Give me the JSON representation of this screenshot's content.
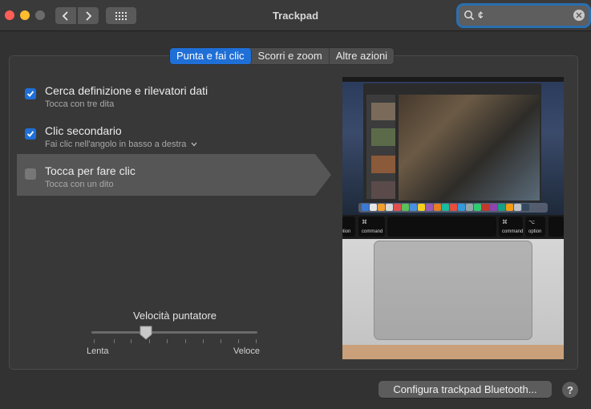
{
  "window": {
    "title": "Trackpad"
  },
  "search": {
    "value": "¢"
  },
  "tabs": [
    {
      "label": "Punta e fai clic",
      "active": true
    },
    {
      "label": "Scorri e zoom",
      "active": false
    },
    {
      "label": "Altre azioni",
      "active": false
    }
  ],
  "options": [
    {
      "title": "Cerca definizione e rilevatori dati",
      "subtitle": "Tocca con tre dita",
      "checked": true
    },
    {
      "title": "Clic secondario",
      "subtitle": "Fai clic nell'angolo in basso a destra",
      "checked": true
    },
    {
      "title": "Tocca per fare clic",
      "subtitle": "Tocca con un dito",
      "checked": false
    }
  ],
  "speed": {
    "title": "Velocità puntatore",
    "min_label": "Lenta",
    "max_label": "Veloce",
    "value_fraction": 0.33
  },
  "keyboard": {
    "left": {
      "label": "option",
      "symbol": "⌥"
    },
    "cmd_left": {
      "label": "command",
      "symbol": "⌘"
    },
    "cmd_right": {
      "label": "command",
      "symbol": "⌘"
    },
    "right": {
      "label": "option",
      "symbol": "⌥"
    }
  },
  "footer": {
    "bluetooth_button": "Configura trackpad Bluetooth...",
    "help_label": "?"
  },
  "colors": {
    "accent": "#1f6fd6",
    "close": "#ff5f57",
    "minimize": "#febc2e"
  }
}
